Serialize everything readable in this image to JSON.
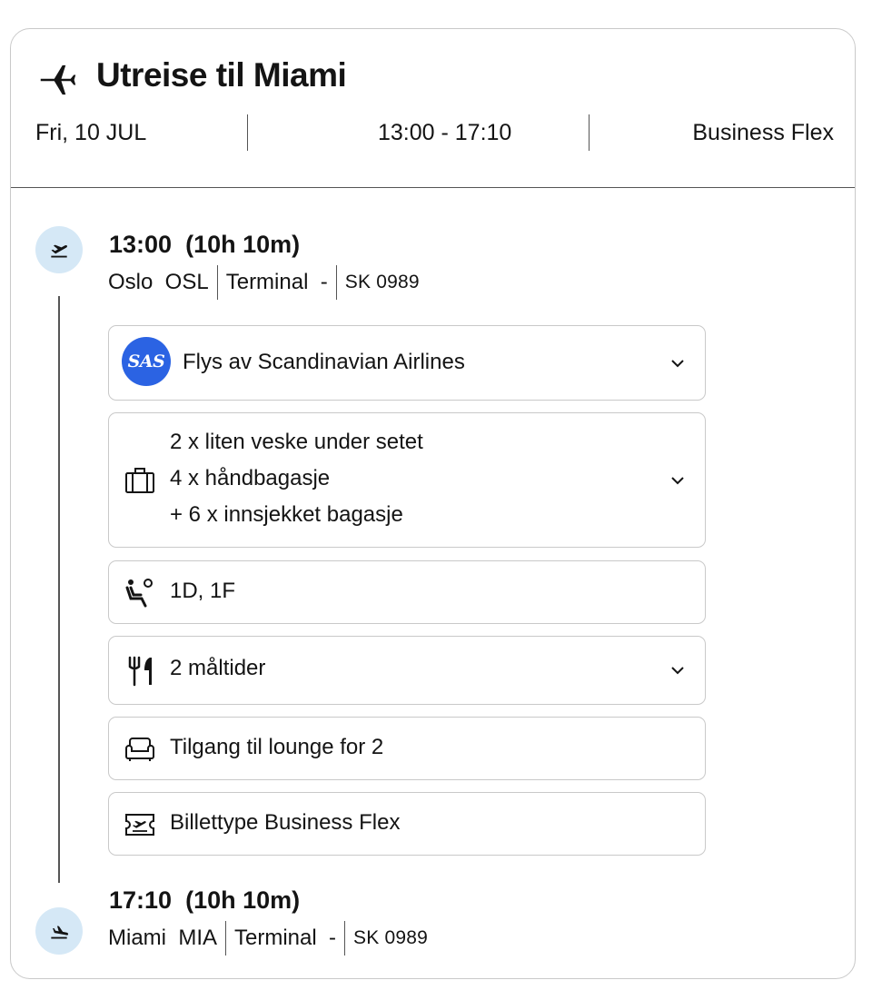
{
  "header": {
    "title": "Utreise til Miami",
    "date": "Fri, 10 JUL",
    "time_range": "13:00 - 17:10",
    "fare": "Business Flex"
  },
  "departure": {
    "time": "13:00",
    "duration": "(10h 10m)",
    "city": "Oslo  OSL",
    "terminal": "Terminal  -",
    "flight": "SK 0989"
  },
  "arrival": {
    "time": "17:10",
    "duration": "(10h 10m)",
    "city": "Miami  MIA",
    "terminal": "Terminal  -",
    "flight": "SK 0989"
  },
  "airline": {
    "logo_text": "SAS",
    "label": "Flys av Scandinavian Airlines"
  },
  "baggage": {
    "lines": [
      "2 x liten veske under setet",
      "4 x håndbagasje",
      "+ 6 x innsjekket bagasje"
    ]
  },
  "seats": {
    "label": "1D, 1F"
  },
  "meals": {
    "label": "2 måltider"
  },
  "lounge": {
    "label": "Tilgang til lounge for 2"
  },
  "ticket": {
    "label": "Billettype Business Flex"
  },
  "icons": {
    "header": "airplane-icon",
    "departure": "takeoff-icon",
    "arrival": "landing-icon",
    "baggage": "suitcase-icon",
    "seats": "seat-icon",
    "meals": "cutlery-icon",
    "lounge": "sofa-icon",
    "ticket": "ticket-icon",
    "expand": "chevron-down-icon"
  },
  "colors": {
    "accent_blue": "#2b63e3",
    "stop_circle": "#d5e8f6",
    "border": "#c9c9c9",
    "text": "#141414"
  }
}
